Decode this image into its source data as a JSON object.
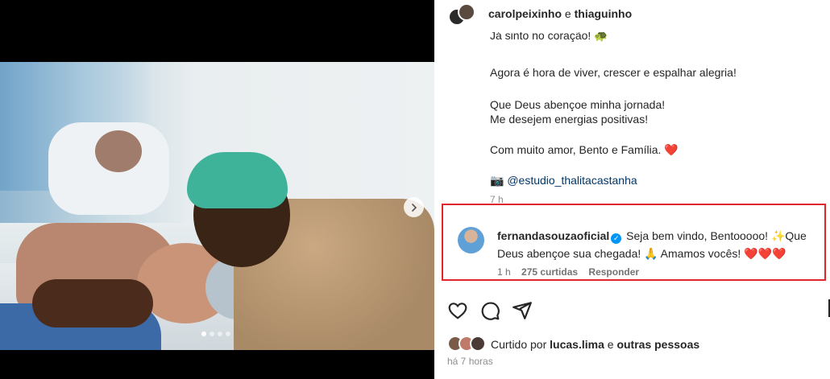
{
  "post": {
    "authors": {
      "first": "carolpeixinho",
      "conj": "e",
      "second": "thiaguinho"
    },
    "caption": {
      "line_partial": "Já sinto no coração! 🐢",
      "line1": "Agora é hora de viver, crescer e espalhar alegria!",
      "line2": "Que Deus abençoe minha jornada!",
      "line3": "Me desejem energias positivas!",
      "line4": "Com muito amor, Bento e Família.",
      "heart": "❤️",
      "camera": "📷",
      "credit_link": "@estudio_thalitacastanha",
      "time": "7 h"
    },
    "carousel": {
      "count": 4,
      "active": 0
    },
    "colors": {
      "highlight": "#e0262b",
      "link": "#00376b",
      "verified": "#0095f6"
    }
  },
  "comment": {
    "username": "fernandasouzaoficial",
    "verified_icon": "verified-badge-icon",
    "text_part1": "Seja bem vindo, Bentooooo! ✨Que",
    "text_part2": "Deus abençoe sua chegada! 🙏 Amamos vocês! ❤️❤️❤️",
    "time": "1 h",
    "likes": "275 curtidas",
    "reply": "Responder"
  },
  "likes": {
    "prefix": "Curtido por",
    "user": "lucas.lima",
    "conj": "e",
    "others": "outras pessoas"
  },
  "posted": "há 7 horas",
  "icons": [
    "heart-icon",
    "comment-icon",
    "share-icon",
    "chevron-right-icon"
  ]
}
